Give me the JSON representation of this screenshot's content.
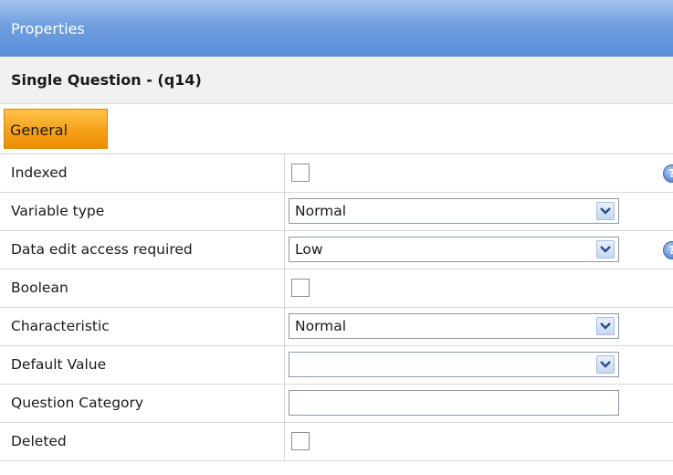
{
  "panel": {
    "title": "Properties",
    "subtitle": "Single Question - (q14)",
    "tabs": [
      {
        "label": "General",
        "active": true
      }
    ]
  },
  "rows": [
    {
      "label": "Indexed",
      "control": "checkbox",
      "checked": false,
      "help": true
    },
    {
      "label": "Variable type",
      "control": "select",
      "value": "Normal"
    },
    {
      "label": "Data edit access required",
      "control": "select",
      "value": "Low",
      "help": true
    },
    {
      "label": "Boolean",
      "control": "checkbox",
      "checked": false
    },
    {
      "label": "Characteristic",
      "control": "select",
      "value": "Normal"
    },
    {
      "label": "Default Value",
      "control": "select",
      "value": ""
    },
    {
      "label": "Question Category",
      "control": "text",
      "value": ""
    },
    {
      "label": "Deleted",
      "control": "checkbox",
      "checked": false
    }
  ],
  "icons": {
    "dropdown": "chevron-down-icon",
    "help": "help-icon"
  },
  "colors": {
    "title_bar": "#6f9fe0",
    "active_tab": "#f5a118",
    "select_button": "#c7d8f3",
    "help_icon": "#4f7ec9"
  }
}
